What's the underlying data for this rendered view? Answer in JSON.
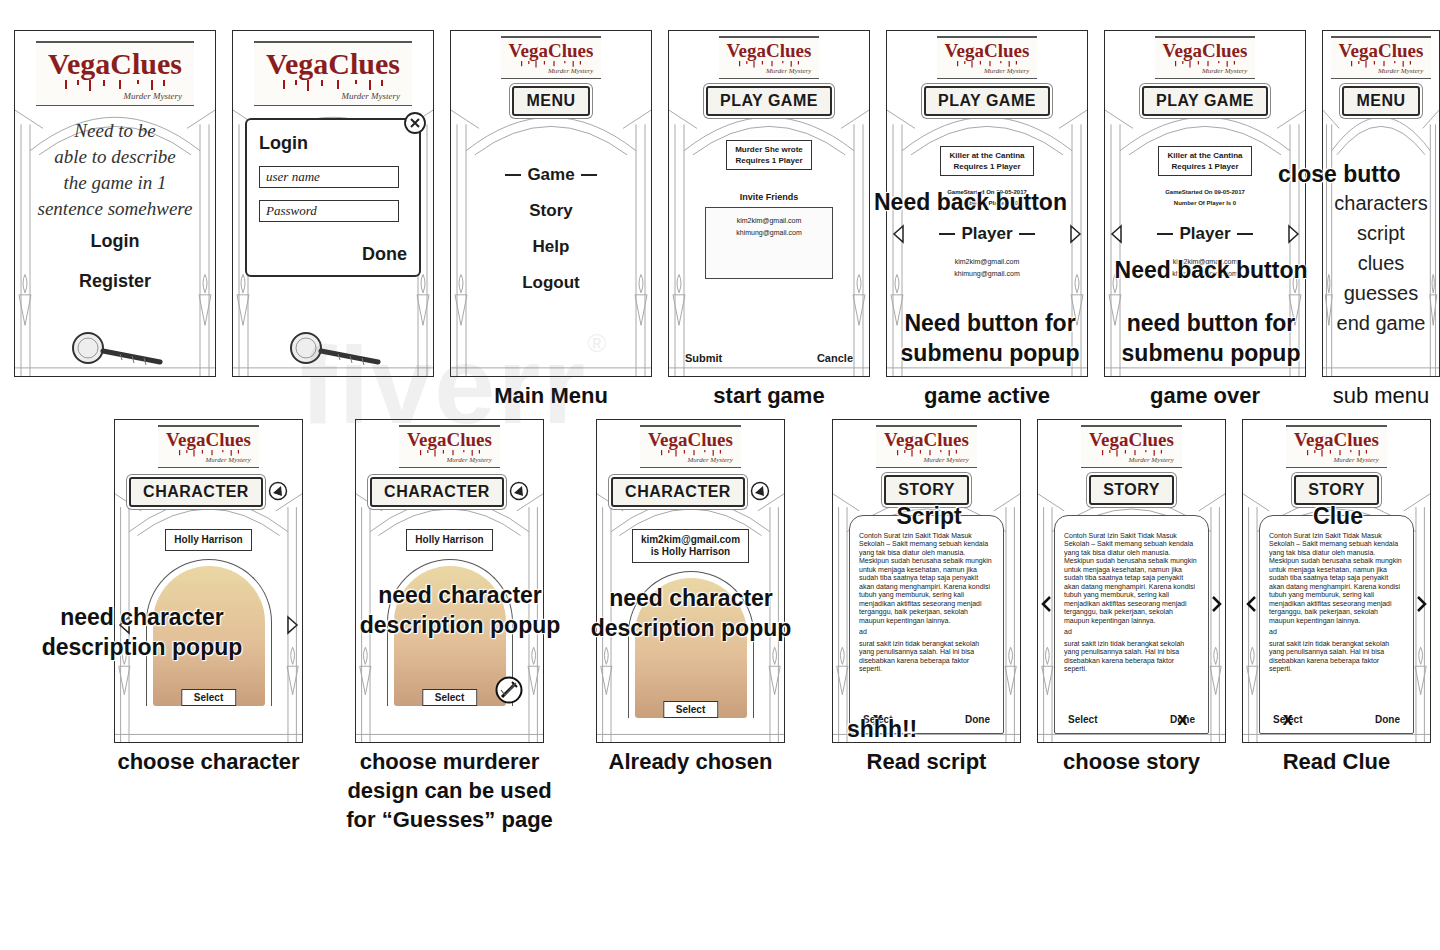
{
  "logo": {
    "title": "VegaClues",
    "subtitle": "Murder Mystery"
  },
  "watermark": {
    "text": "fiverr",
    "mark": "®"
  },
  "cross_mark": "x",
  "top_row": [
    {
      "kind": "login",
      "note": "Need to be\nable to describe\nthe game in 1\nsentence somehwere",
      "buttons": [
        "Login",
        "Register"
      ]
    },
    {
      "kind": "login-popup",
      "popup": {
        "title": "Login",
        "fields": [
          "user name",
          "Password"
        ],
        "submit": "Done"
      }
    },
    {
      "kind": "menu",
      "title": "MENU",
      "items": [
        {
          "label": "Game",
          "selected": true
        },
        {
          "label": "Story",
          "selected": false
        },
        {
          "label": "Help",
          "selected": false
        },
        {
          "label": "Logout",
          "selected": false
        }
      ],
      "caption": "Main Menu"
    },
    {
      "kind": "invite",
      "title": "PLAY GAME",
      "card": [
        "Murder She wrote",
        "Requires 1 Player"
      ],
      "invite_label": "Invite Friends",
      "emails": [
        "kim2kim@gmail.com",
        "khimung@gmail.com"
      ],
      "actions": [
        "Submit",
        "Cancle"
      ],
      "caption": "start game"
    },
    {
      "kind": "game",
      "title": "PLAY GAME",
      "card": [
        "Killer at the Cantina",
        "Requires 1 Player"
      ],
      "meta": [
        "GameStarted On 09-05-2017",
        "Number Of Player Is 0"
      ],
      "section": "Player",
      "emails": [
        "kim2kim@gmail.com",
        "khimung@gmail.com"
      ],
      "annotations": [
        "Need back button",
        "Need button for\nsubmenu popup"
      ],
      "caption": "game active"
    },
    {
      "kind": "game",
      "title": "PLAY GAME",
      "card": [
        "Killer at the Cantina",
        "Requires 1 Player"
      ],
      "meta": [
        "GameStarted On 09-05-2017",
        "Number Of Player Is 0"
      ],
      "section": "Player",
      "emails": [
        "kim2kim@gmail.com",
        "khimung@gmail.com"
      ],
      "annotations": [
        "Need back button",
        "need button for\nsubmenu popup"
      ],
      "caption": "game over"
    },
    {
      "kind": "submenu",
      "title": "MENU",
      "items": [
        "characters",
        "script",
        "clues",
        "guesses",
        "end game"
      ],
      "annotations": [
        "close butto"
      ],
      "caption": "sub menu"
    }
  ],
  "characters": [
    {
      "title": "CHARACTER",
      "name_lines": [
        "Holly Harrison"
      ],
      "select": "Select",
      "arrows": true,
      "murderer": false,
      "annotations": [
        "need character\ndescription popup"
      ],
      "caption": "choose character"
    },
    {
      "title": "CHARACTER",
      "name_lines": [
        "Holly Harrison"
      ],
      "select": "Select",
      "arrows": false,
      "murderer": true,
      "annotations": [
        "need character\ndescription popup"
      ],
      "caption": "choose murderer\ndesign can be used\nfor “Guesses” page"
    },
    {
      "title": "CHARACTER",
      "name_lines": [
        "kim2kim@gmail.com",
        "is Holly Harrison"
      ],
      "select": "Select",
      "arrows": false,
      "murderer": false,
      "annotations": [
        "need character\ndescription popup"
      ],
      "caption": "Already chosen"
    }
  ],
  "stories": [
    {
      "title": "STORY",
      "paragraphs": [
        "Contoh Surat Izin Sakit Tidak Masuk Sekolah – Sakit memang sebuah kendala yang tak bisa diatur oleh manusia. Meskipun sudah berusaha sebaik mungkin untuk menjaga kesehatan, namun jika sudah tiba saatnya tetap saja penyakit akan datang menghampiri. Karena kondisi tubuh yang memburuk, sering kali menjadikan aktifitas seseorang menjadi terganggu, baik pekerjaan, sekolah maupun kepentingan lainnya.",
        "ad",
        "surat sakit izin tidak berangkat sekolah yang penulisannya salah. Hal ini bisa disebabkan karena beberapa faktor seperti."
      ],
      "actions": [
        {
          "label": "Select",
          "crossed": true
        },
        {
          "label": "Done",
          "crossed": false
        }
      ],
      "arrows": false,
      "annotations": [
        "Script",
        "shhh!!"
      ],
      "caption": "Read script"
    },
    {
      "title": "STORY",
      "paragraphs": [
        "Contoh Surat Izin Sakit Tidak Masuk Sekolah – Sakit memang sebuah kendala yang tak bisa diatur oleh manusia. Meskipun sudah berusaha sebaik mungkin untuk menjaga kesehatan, namun jika sudah tiba saatnya tetap saja penyakit akan datang menghampiri. Karena kondisi tubuh yang memburuk, sering kali menjadikan aktifitas seseorang menjadi terganggu, baik pekerjaan, sekolah maupun kepentingan lainnya.",
        "ad",
        "surat sakit izin tidak berangkat sekolah yang penulisannya salah. Hal ini bisa disebabkan karena beberapa faktor seperti."
      ],
      "actions": [
        {
          "label": "Select",
          "crossed": false
        },
        {
          "label": "Done",
          "crossed": true
        }
      ],
      "arrows": true,
      "annotations": [],
      "caption": "choose story"
    },
    {
      "title": "STORY",
      "paragraphs": [
        "Contoh Surat Izin Sakit Tidak Masuk Sekolah – Sakit memang sebuah kendala yang tak bisa diatur oleh manusia. Meskipun sudah berusaha sebaik mungkin untuk menjaga kesehatan, namun jika sudah tiba saatnya tetap saja penyakit akan datang menghampiri. Karena kondisi tubuh yang memburuk, sering kali menjadikan aktifitas seseorang menjadi terganggu, baik pekerjaan, sekolah maupun kepentingan lainnya.",
        "ad",
        "surat sakit izin tidak berangkat sekolah yang penulisannya salah. Hal ini bisa disebabkan karena beberapa faktor seperti."
      ],
      "actions": [
        {
          "label": "Select",
          "crossed": true
        },
        {
          "label": "Done",
          "crossed": false
        }
      ],
      "arrows": true,
      "annotations": [
        "Clue"
      ],
      "caption": "Read Clue"
    }
  ]
}
